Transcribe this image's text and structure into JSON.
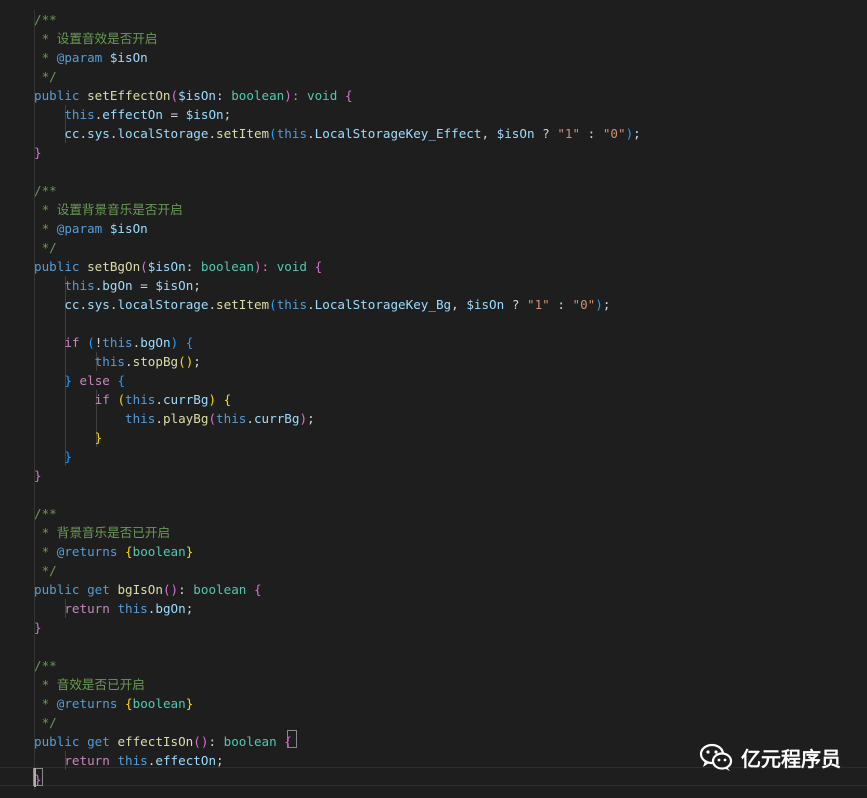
{
  "colors": {
    "background": "#1e1e1e",
    "comment": "#6a9955",
    "keyword": "#569cd6",
    "control": "#c586c0",
    "function": "#dcdcaa",
    "variable": "#9cdcfe",
    "type": "#4ec9b0",
    "string": "#ce9178",
    "plain": "#d4d4d4",
    "bracket1": "#ffd700",
    "bracket2": "#da70d6",
    "bracket3": "#179fff"
  },
  "code_lines": [
    [
      [
        "/**",
        "comment"
      ]
    ],
    [
      [
        " * 设置音效是否开启",
        "comment"
      ]
    ],
    [
      [
        " * ",
        "comment"
      ],
      [
        "@param",
        "keyword"
      ],
      [
        " ",
        "comment"
      ],
      [
        "$isOn",
        "variable"
      ]
    ],
    [
      [
        " */",
        "comment"
      ]
    ],
    [
      [
        "public",
        "keyword"
      ],
      [
        " ",
        "plain"
      ],
      [
        "setEffectOn",
        "function"
      ],
      [
        "(",
        "bracket2"
      ],
      [
        "$isOn",
        "variable"
      ],
      [
        ": ",
        "plain"
      ],
      [
        "boolean",
        "type"
      ],
      [
        "): ",
        "bracket2"
      ],
      [
        "void",
        "type"
      ],
      [
        " ",
        "plain"
      ],
      [
        "{",
        "bracket2"
      ]
    ],
    [
      [
        "    ",
        "plain"
      ],
      [
        "this",
        "keyword"
      ],
      [
        ".",
        "plain"
      ],
      [
        "effectOn",
        "variable"
      ],
      [
        " = ",
        "plain"
      ],
      [
        "$isOn",
        "variable"
      ],
      [
        ";",
        "plain"
      ]
    ],
    [
      [
        "    ",
        "plain"
      ],
      [
        "cc",
        "variable"
      ],
      [
        ".",
        "plain"
      ],
      [
        "sys",
        "variable"
      ],
      [
        ".",
        "plain"
      ],
      [
        "localStorage",
        "variable"
      ],
      [
        ".",
        "plain"
      ],
      [
        "setItem",
        "function"
      ],
      [
        "(",
        "bracket3"
      ],
      [
        "this",
        "keyword"
      ],
      [
        ".",
        "plain"
      ],
      [
        "LocalStorageKey_Effect",
        "variable"
      ],
      [
        ", ",
        "plain"
      ],
      [
        "$isOn",
        "variable"
      ],
      [
        " ? ",
        "plain"
      ],
      [
        "\"1\"",
        "string"
      ],
      [
        " : ",
        "plain"
      ],
      [
        "\"0\"",
        "string"
      ],
      [
        ")",
        "bracket3"
      ],
      [
        ";",
        "plain"
      ]
    ],
    [
      [
        "}",
        "bracket2"
      ]
    ],
    [],
    [
      [
        "/**",
        "comment"
      ]
    ],
    [
      [
        " * 设置背景音乐是否开启",
        "comment"
      ]
    ],
    [
      [
        " * ",
        "comment"
      ],
      [
        "@param",
        "keyword"
      ],
      [
        " ",
        "comment"
      ],
      [
        "$isOn",
        "variable"
      ]
    ],
    [
      [
        " */",
        "comment"
      ]
    ],
    [
      [
        "public",
        "keyword"
      ],
      [
        " ",
        "plain"
      ],
      [
        "setBgOn",
        "function"
      ],
      [
        "(",
        "bracket2"
      ],
      [
        "$isOn",
        "variable"
      ],
      [
        ": ",
        "plain"
      ],
      [
        "boolean",
        "type"
      ],
      [
        "): ",
        "bracket2"
      ],
      [
        "void",
        "type"
      ],
      [
        " ",
        "plain"
      ],
      [
        "{",
        "bracket2"
      ]
    ],
    [
      [
        "    ",
        "plain"
      ],
      [
        "this",
        "keyword"
      ],
      [
        ".",
        "plain"
      ],
      [
        "bgOn",
        "variable"
      ],
      [
        " = ",
        "plain"
      ],
      [
        "$isOn",
        "variable"
      ],
      [
        ";",
        "plain"
      ]
    ],
    [
      [
        "    ",
        "plain"
      ],
      [
        "cc",
        "variable"
      ],
      [
        ".",
        "plain"
      ],
      [
        "sys",
        "variable"
      ],
      [
        ".",
        "plain"
      ],
      [
        "localStorage",
        "variable"
      ],
      [
        ".",
        "plain"
      ],
      [
        "setItem",
        "function"
      ],
      [
        "(",
        "bracket3"
      ],
      [
        "this",
        "keyword"
      ],
      [
        ".",
        "plain"
      ],
      [
        "LocalStorageKey_Bg",
        "variable"
      ],
      [
        ", ",
        "plain"
      ],
      [
        "$isOn",
        "variable"
      ],
      [
        " ? ",
        "plain"
      ],
      [
        "\"1\"",
        "string"
      ],
      [
        " : ",
        "plain"
      ],
      [
        "\"0\"",
        "string"
      ],
      [
        ")",
        "bracket3"
      ],
      [
        ";",
        "plain"
      ]
    ],
    [],
    [
      [
        "    ",
        "plain"
      ],
      [
        "if",
        "control"
      ],
      [
        " ",
        "plain"
      ],
      [
        "(",
        "bracket3"
      ],
      [
        "!",
        "plain"
      ],
      [
        "this",
        "keyword"
      ],
      [
        ".",
        "plain"
      ],
      [
        "bgOn",
        "variable"
      ],
      [
        ")",
        "bracket3"
      ],
      [
        " ",
        "plain"
      ],
      [
        "{",
        "bracket3"
      ]
    ],
    [
      [
        "        ",
        "plain"
      ],
      [
        "this",
        "keyword"
      ],
      [
        ".",
        "plain"
      ],
      [
        "stopBg",
        "function"
      ],
      [
        "()",
        "bracket1"
      ],
      [
        ";",
        "plain"
      ]
    ],
    [
      [
        "    ",
        "plain"
      ],
      [
        "}",
        "bracket3"
      ],
      [
        " ",
        "plain"
      ],
      [
        "else",
        "control"
      ],
      [
        " ",
        "plain"
      ],
      [
        "{",
        "bracket3"
      ]
    ],
    [
      [
        "        ",
        "plain"
      ],
      [
        "if",
        "control"
      ],
      [
        " ",
        "plain"
      ],
      [
        "(",
        "bracket1"
      ],
      [
        "this",
        "keyword"
      ],
      [
        ".",
        "plain"
      ],
      [
        "currBg",
        "variable"
      ],
      [
        ")",
        "bracket1"
      ],
      [
        " ",
        "plain"
      ],
      [
        "{",
        "bracket1"
      ]
    ],
    [
      [
        "            ",
        "plain"
      ],
      [
        "this",
        "keyword"
      ],
      [
        ".",
        "plain"
      ],
      [
        "playBg",
        "function"
      ],
      [
        "(",
        "bracket2"
      ],
      [
        "this",
        "keyword"
      ],
      [
        ".",
        "plain"
      ],
      [
        "currBg",
        "variable"
      ],
      [
        ")",
        "bracket2"
      ],
      [
        ";",
        "plain"
      ]
    ],
    [
      [
        "        ",
        "plain"
      ],
      [
        "}",
        "bracket1"
      ]
    ],
    [
      [
        "    ",
        "plain"
      ],
      [
        "}",
        "bracket3"
      ]
    ],
    [
      [
        "}",
        "bracket2"
      ]
    ],
    [],
    [
      [
        "/**",
        "comment"
      ]
    ],
    [
      [
        " * 背景音乐是否已开启",
        "comment"
      ]
    ],
    [
      [
        " * ",
        "comment"
      ],
      [
        "@returns",
        "keyword"
      ],
      [
        " ",
        "comment"
      ],
      [
        "{",
        "bracket1"
      ],
      [
        "boolean",
        "type"
      ],
      [
        "}",
        "bracket1"
      ]
    ],
    [
      [
        " */",
        "comment"
      ]
    ],
    [
      [
        "public",
        "keyword"
      ],
      [
        " ",
        "plain"
      ],
      [
        "get",
        "keyword"
      ],
      [
        " ",
        "plain"
      ],
      [
        "bgIsOn",
        "function"
      ],
      [
        "()",
        "bracket2"
      ],
      [
        ": ",
        "plain"
      ],
      [
        "boolean",
        "type"
      ],
      [
        " ",
        "plain"
      ],
      [
        "{",
        "bracket2"
      ]
    ],
    [
      [
        "    ",
        "plain"
      ],
      [
        "return",
        "control"
      ],
      [
        " ",
        "plain"
      ],
      [
        "this",
        "keyword"
      ],
      [
        ".",
        "plain"
      ],
      [
        "bgOn",
        "variable"
      ],
      [
        ";",
        "plain"
      ]
    ],
    [
      [
        "}",
        "bracket2"
      ]
    ],
    [],
    [
      [
        "/**",
        "comment"
      ]
    ],
    [
      [
        " * 音效是否已开启",
        "comment"
      ]
    ],
    [
      [
        " * ",
        "comment"
      ],
      [
        "@returns",
        "keyword"
      ],
      [
        " ",
        "comment"
      ],
      [
        "{",
        "bracket1"
      ],
      [
        "boolean",
        "type"
      ],
      [
        "}",
        "bracket1"
      ]
    ],
    [
      [
        " */",
        "comment"
      ]
    ],
    [
      [
        "public",
        "keyword"
      ],
      [
        " ",
        "plain"
      ],
      [
        "get",
        "keyword"
      ],
      [
        " ",
        "plain"
      ],
      [
        "effectIsOn",
        "function"
      ],
      [
        "()",
        "bracket2"
      ],
      [
        ": ",
        "plain"
      ],
      [
        "boolean",
        "type"
      ],
      [
        " ",
        "plain"
      ],
      [
        "{",
        "bracket2"
      ]
    ],
    [
      [
        "    ",
        "plain"
      ],
      [
        "return",
        "control"
      ],
      [
        " ",
        "plain"
      ],
      [
        "this",
        "keyword"
      ],
      [
        ".",
        "plain"
      ],
      [
        "effectOn",
        "variable"
      ],
      [
        ";",
        "plain"
      ]
    ],
    [
      [
        "}",
        "bracket2"
      ]
    ]
  ],
  "watermark": {
    "icon": "wechat-icon",
    "text": "亿元程序员"
  }
}
